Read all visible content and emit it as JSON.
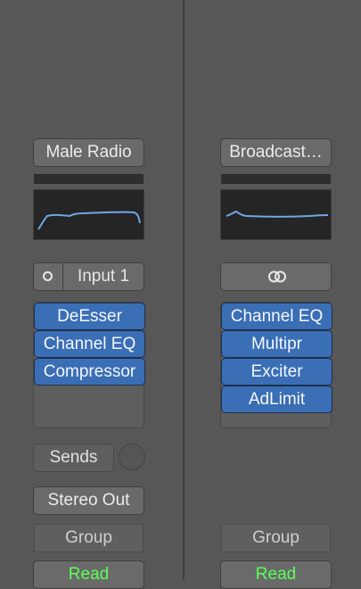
{
  "left_strip": {
    "setting": "Male Radio",
    "input_label": "Input 1",
    "inserts": [
      "DeEsser",
      "Channel EQ",
      "Compressor"
    ],
    "sends_label": "Sends",
    "output": "Stereo Out",
    "group": "Group",
    "automation": "Read"
  },
  "right_strip": {
    "setting": "Broadcast…",
    "inserts": [
      "Channel EQ",
      "Multipr",
      "Exciter",
      "AdLimit"
    ],
    "group": "Group",
    "automation": "Read"
  },
  "icons": {
    "input_format": "mono-ring-icon",
    "stereo_link": "stereo-link-icon"
  },
  "colors": {
    "plugin_slot": "#3a6eb5",
    "eq_curve": "#6fa6e6",
    "read_text": "#5bff5b"
  }
}
